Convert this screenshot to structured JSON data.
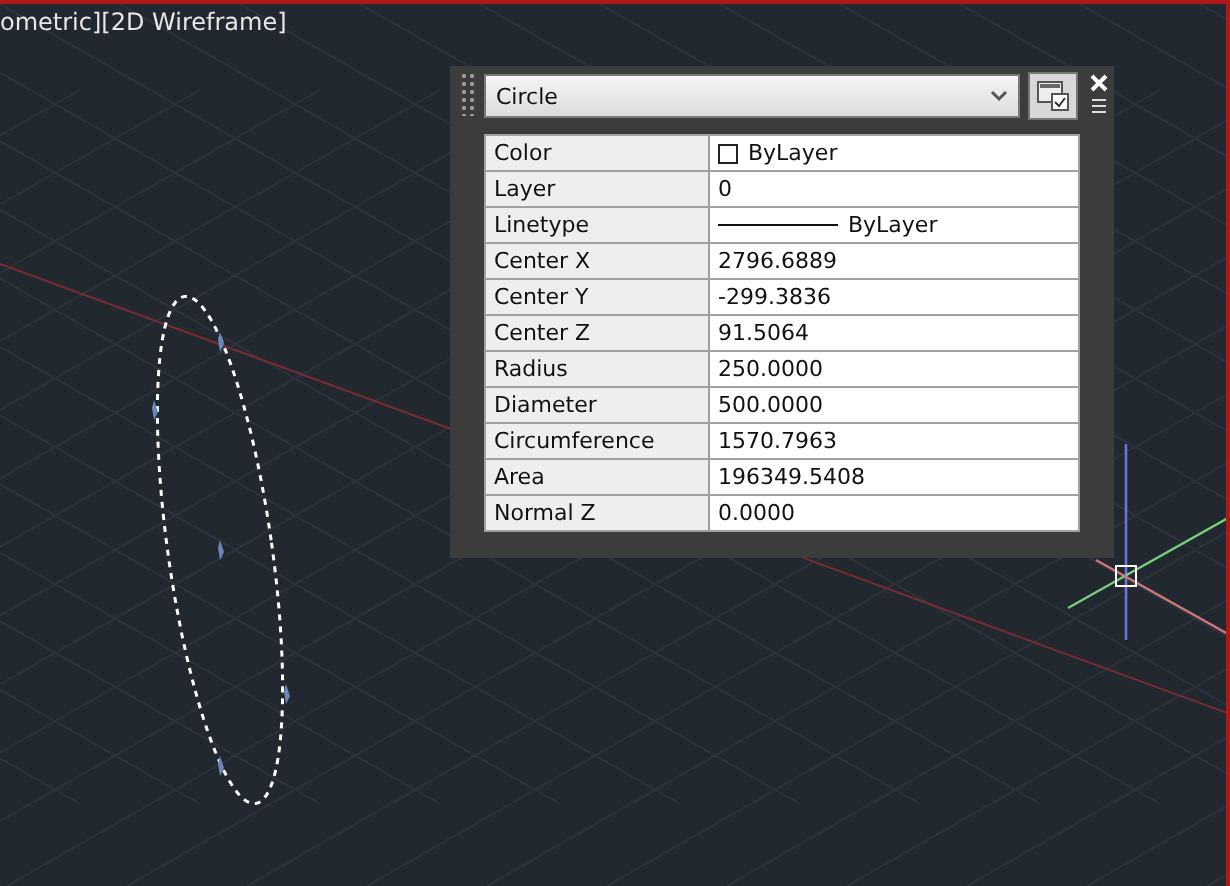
{
  "viewport": {
    "label": "ometric][2D Wireframe]"
  },
  "palette": {
    "object_type": "Circle",
    "properties": [
      {
        "name": "Color",
        "value": "ByLayer",
        "kind": "color"
      },
      {
        "name": "Layer",
        "value": "0",
        "kind": "text"
      },
      {
        "name": "Linetype",
        "value": "ByLayer",
        "kind": "linetype"
      },
      {
        "name": "Center X",
        "value": "2796.6889",
        "kind": "text"
      },
      {
        "name": "Center Y",
        "value": "-299.3836",
        "kind": "text"
      },
      {
        "name": "Center Z",
        "value": "91.5064",
        "kind": "text"
      },
      {
        "name": "Radius",
        "value": "250.0000",
        "kind": "text"
      },
      {
        "name": "Diameter",
        "value": "500.0000",
        "kind": "text"
      },
      {
        "name": "Circumference",
        "value": "1570.7963",
        "kind": "text"
      },
      {
        "name": "Area",
        "value": "196349.5408",
        "kind": "text"
      },
      {
        "name": "Normal Z",
        "value": "0.0000",
        "kind": "text"
      }
    ]
  }
}
